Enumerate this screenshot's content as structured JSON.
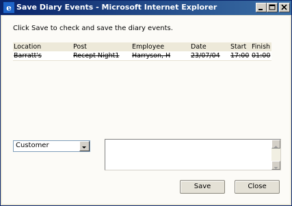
{
  "window": {
    "title": "Save Diary Events - Microsoft Internet Explorer",
    "icon": "internet-explorer-icon",
    "controls": [
      "minimize-icon",
      "maximize-icon",
      "close-icon"
    ]
  },
  "instruction": "Click Save to check and save the diary events.",
  "table": {
    "columns": {
      "location": "Location",
      "post": "Post",
      "employee": "Employee",
      "date": "Date",
      "start": "Start",
      "finish": "Finish"
    },
    "rows": [
      {
        "location": "Barratt's",
        "post": "Recept Night1",
        "employee": "Harryson, H",
        "date": "23/07/04",
        "start": "17:00",
        "finish": "01:00",
        "strikethrough": true
      }
    ]
  },
  "category_select": {
    "selected": "Customer"
  },
  "notes_box": {
    "value": ""
  },
  "buttons": {
    "save": "Save",
    "close": "Close"
  },
  "colors": {
    "titlebar_start": "#0a246a",
    "titlebar_end": "#3a6ea5",
    "dialog_bg": "#fcfbf7",
    "header_bg": "#ede9d9"
  }
}
